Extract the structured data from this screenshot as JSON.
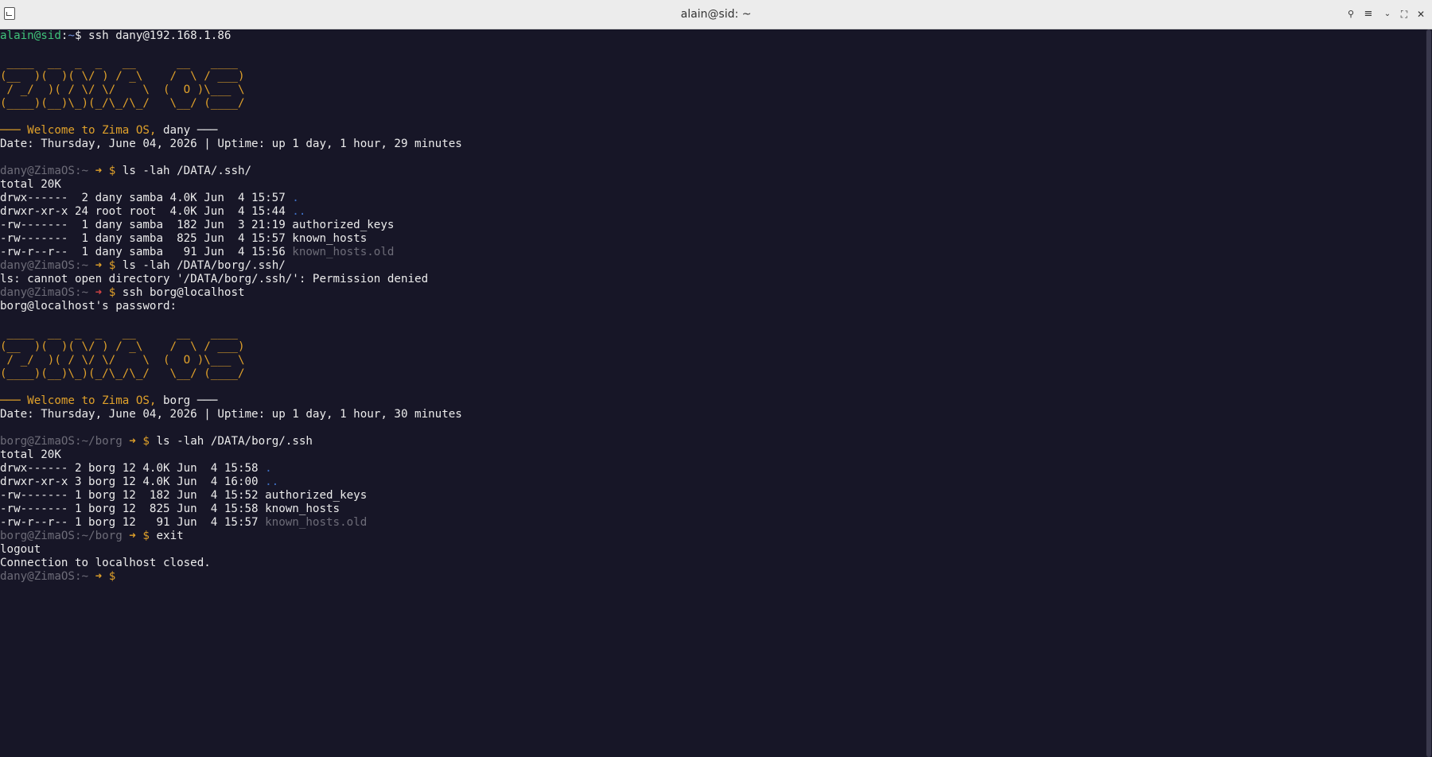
{
  "window": {
    "title": "alain@sid: ~",
    "icons": {
      "app": "terminal-icon",
      "search": "search-icon",
      "menu": "hamburger-menu-icon",
      "minimize": "chevron-down-icon",
      "maximize": "maximize-icon",
      "close": "close-icon"
    },
    "glyphs": {
      "search": "⚲",
      "menu": "≡",
      "minimize": "⌄",
      "maximize": "⛶",
      "close": "✕"
    }
  },
  "colors": {
    "background": "#171627",
    "text": "#ececec",
    "green": "#3fc37a",
    "blue": "#6f8fd8",
    "yellow": "#e0a12a",
    "red": "#d64545",
    "dim": "#6d6c78",
    "dotblue": "#3f6fc4"
  },
  "terminal": {
    "lines": [
      [
        {
          "t": "alain@sid",
          "c": "green"
        },
        {
          "t": ":",
          "c": "text"
        },
        {
          "t": "~",
          "c": "blue"
        },
        {
          "t": "$ ssh dany@192.168.1.86",
          "c": "text"
        }
      ],
      [],
      [
        {
          "t": " ____  __  _  _   __      __   ____",
          "c": "yellow"
        }
      ],
      [
        {
          "t": "(__  )(  )( \\/ ) / _\\    /  \\ / ___)",
          "c": "yellow"
        }
      ],
      [
        {
          "t": " / _/  )( / \\/ \\/    \\  (  O )\\___ \\",
          "c": "yellow"
        }
      ],
      [
        {
          "t": "(____)(__)\\_)(_/\\_/\\_/   \\__/ (____/",
          "c": "yellow"
        }
      ],
      [],
      [
        {
          "t": "─── Welcome to Zima OS, ",
          "c": "yellow"
        },
        {
          "t": "dany",
          "c": "text"
        },
        {
          "t": " ───",
          "c": "text"
        }
      ],
      [
        {
          "t": "Date: Thursday, June 04, 2026 | Uptime: up 1 day, 1 hour, 29 minutes",
          "c": "text"
        }
      ],
      [],
      [
        {
          "t": "dany@ZimaOS:~ ",
          "c": "dim"
        },
        {
          "t": "➜ ",
          "c": "yellow"
        },
        {
          "t": "$ ",
          "c": "yellow"
        },
        {
          "t": "ls -lah /DATA/.ssh/",
          "c": "text"
        }
      ],
      [
        {
          "t": "total 20K",
          "c": "text"
        }
      ],
      [
        {
          "t": "drwx------  2 dany samba 4.0K Jun  4 15:57 ",
          "c": "text"
        },
        {
          "t": ".",
          "c": "dotblue"
        }
      ],
      [
        {
          "t": "drwxr-xr-x 24 root root  4.0K Jun  4 15:44 ",
          "c": "text"
        },
        {
          "t": "..",
          "c": "dotblue"
        }
      ],
      [
        {
          "t": "-rw-------  1 dany samba  182 Jun  3 21:19 authorized_keys",
          "c": "text"
        }
      ],
      [
        {
          "t": "-rw-------  1 dany samba  825 Jun  4 15:57 known_hosts",
          "c": "text"
        }
      ],
      [
        {
          "t": "-rw-r--r--  1 dany samba   91 Jun  4 15:56 ",
          "c": "text"
        },
        {
          "t": "known_hosts.old",
          "c": "dim"
        }
      ],
      [
        {
          "t": "dany@ZimaOS:~ ",
          "c": "dim"
        },
        {
          "t": "➜ ",
          "c": "yellow"
        },
        {
          "t": "$ ",
          "c": "yellow"
        },
        {
          "t": "ls -lah /DATA/borg/.ssh/",
          "c": "text"
        }
      ],
      [
        {
          "t": "ls: cannot open directory '/DATA/borg/.ssh/': Permission denied",
          "c": "text"
        }
      ],
      [
        {
          "t": "dany@ZimaOS:~ ",
          "c": "dim"
        },
        {
          "t": "➜ ",
          "c": "red"
        },
        {
          "t": "$ ",
          "c": "yellow"
        },
        {
          "t": "ssh borg@localhost",
          "c": "text"
        }
      ],
      [
        {
          "t": "borg@localhost's password:",
          "c": "text"
        }
      ],
      [],
      [
        {
          "t": " ____  __  _  _   __      __   ____",
          "c": "yellow"
        }
      ],
      [
        {
          "t": "(__  )(  )( \\/ ) / _\\    /  \\ / ___)",
          "c": "yellow"
        }
      ],
      [
        {
          "t": " / _/  )( / \\/ \\/    \\  (  O )\\___ \\",
          "c": "yellow"
        }
      ],
      [
        {
          "t": "(____)(__)\\_)(_/\\_/\\_/   \\__/ (____/",
          "c": "yellow"
        }
      ],
      [],
      [
        {
          "t": "─── Welcome to Zima OS, ",
          "c": "yellow"
        },
        {
          "t": "borg",
          "c": "text"
        },
        {
          "t": " ───",
          "c": "text"
        }
      ],
      [
        {
          "t": "Date: Thursday, June 04, 2026 | Uptime: up 1 day, 1 hour, 30 minutes",
          "c": "text"
        }
      ],
      [],
      [
        {
          "t": "borg@ZimaOS:~/borg ",
          "c": "dim"
        },
        {
          "t": "➜ ",
          "c": "yellow"
        },
        {
          "t": "$ ",
          "c": "yellow"
        },
        {
          "t": "ls -lah /DATA/borg/.ssh",
          "c": "text"
        }
      ],
      [
        {
          "t": "total 20K",
          "c": "text"
        }
      ],
      [
        {
          "t": "drwx------ 2 borg 12 4.0K Jun  4 15:58 ",
          "c": "text"
        },
        {
          "t": ".",
          "c": "dotblue"
        }
      ],
      [
        {
          "t": "drwxr-xr-x 3 borg 12 4.0K Jun  4 16:00 ",
          "c": "text"
        },
        {
          "t": "..",
          "c": "dotblue"
        }
      ],
      [
        {
          "t": "-rw------- 1 borg 12  182 Jun  4 15:52 authorized_keys",
          "c": "text"
        }
      ],
      [
        {
          "t": "-rw------- 1 borg 12  825 Jun  4 15:58 known_hosts",
          "c": "text"
        }
      ],
      [
        {
          "t": "-rw-r--r-- 1 borg 12   91 Jun  4 15:57 ",
          "c": "text"
        },
        {
          "t": "known_hosts.old",
          "c": "dim"
        }
      ],
      [
        {
          "t": "borg@ZimaOS:~/borg ",
          "c": "dim"
        },
        {
          "t": "➜ ",
          "c": "yellow"
        },
        {
          "t": "$ ",
          "c": "yellow"
        },
        {
          "t": "exit",
          "c": "text"
        }
      ],
      [
        {
          "t": "logout",
          "c": "text"
        }
      ],
      [
        {
          "t": "Connection to localhost closed.",
          "c": "text"
        }
      ],
      [
        {
          "t": "dany@ZimaOS:~ ",
          "c": "dim"
        },
        {
          "t": "➜ ",
          "c": "yellow"
        },
        {
          "t": "$ ",
          "c": "yellow"
        }
      ]
    ]
  }
}
